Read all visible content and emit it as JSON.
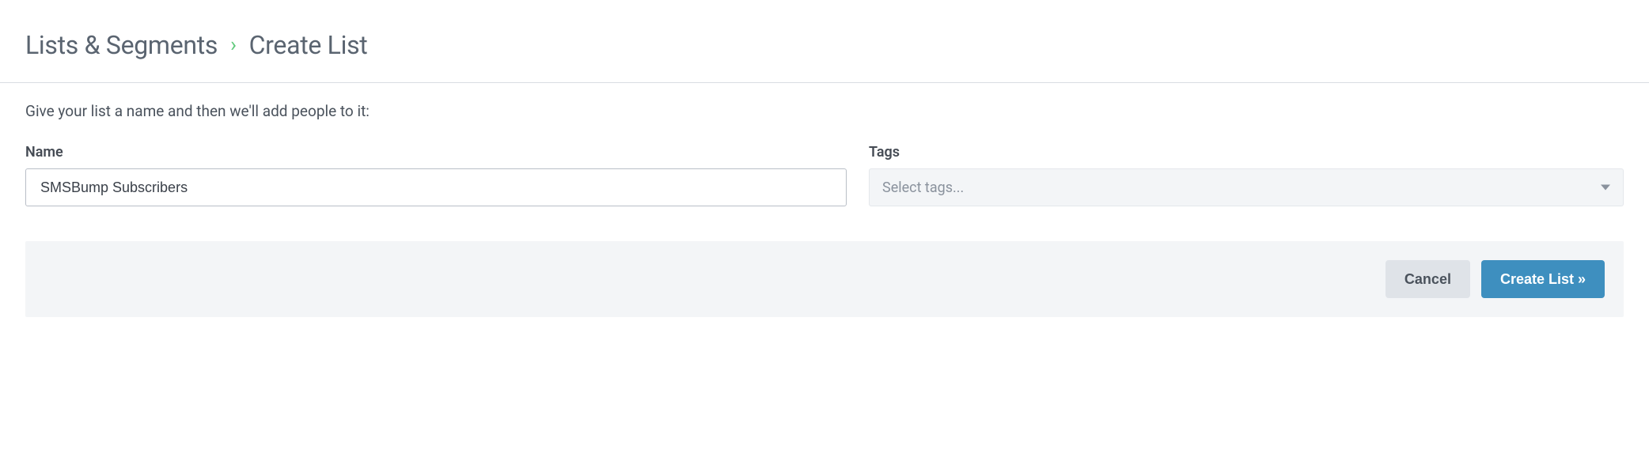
{
  "breadcrumb": {
    "parent": "Lists & Segments",
    "current": "Create List"
  },
  "instruction": "Give your list a name and then we'll add people to it:",
  "form": {
    "name_label": "Name",
    "name_value": "SMSBump Subscribers",
    "tags_label": "Tags",
    "tags_placeholder": "Select tags..."
  },
  "actions": {
    "cancel": "Cancel",
    "submit": "Create List »"
  }
}
